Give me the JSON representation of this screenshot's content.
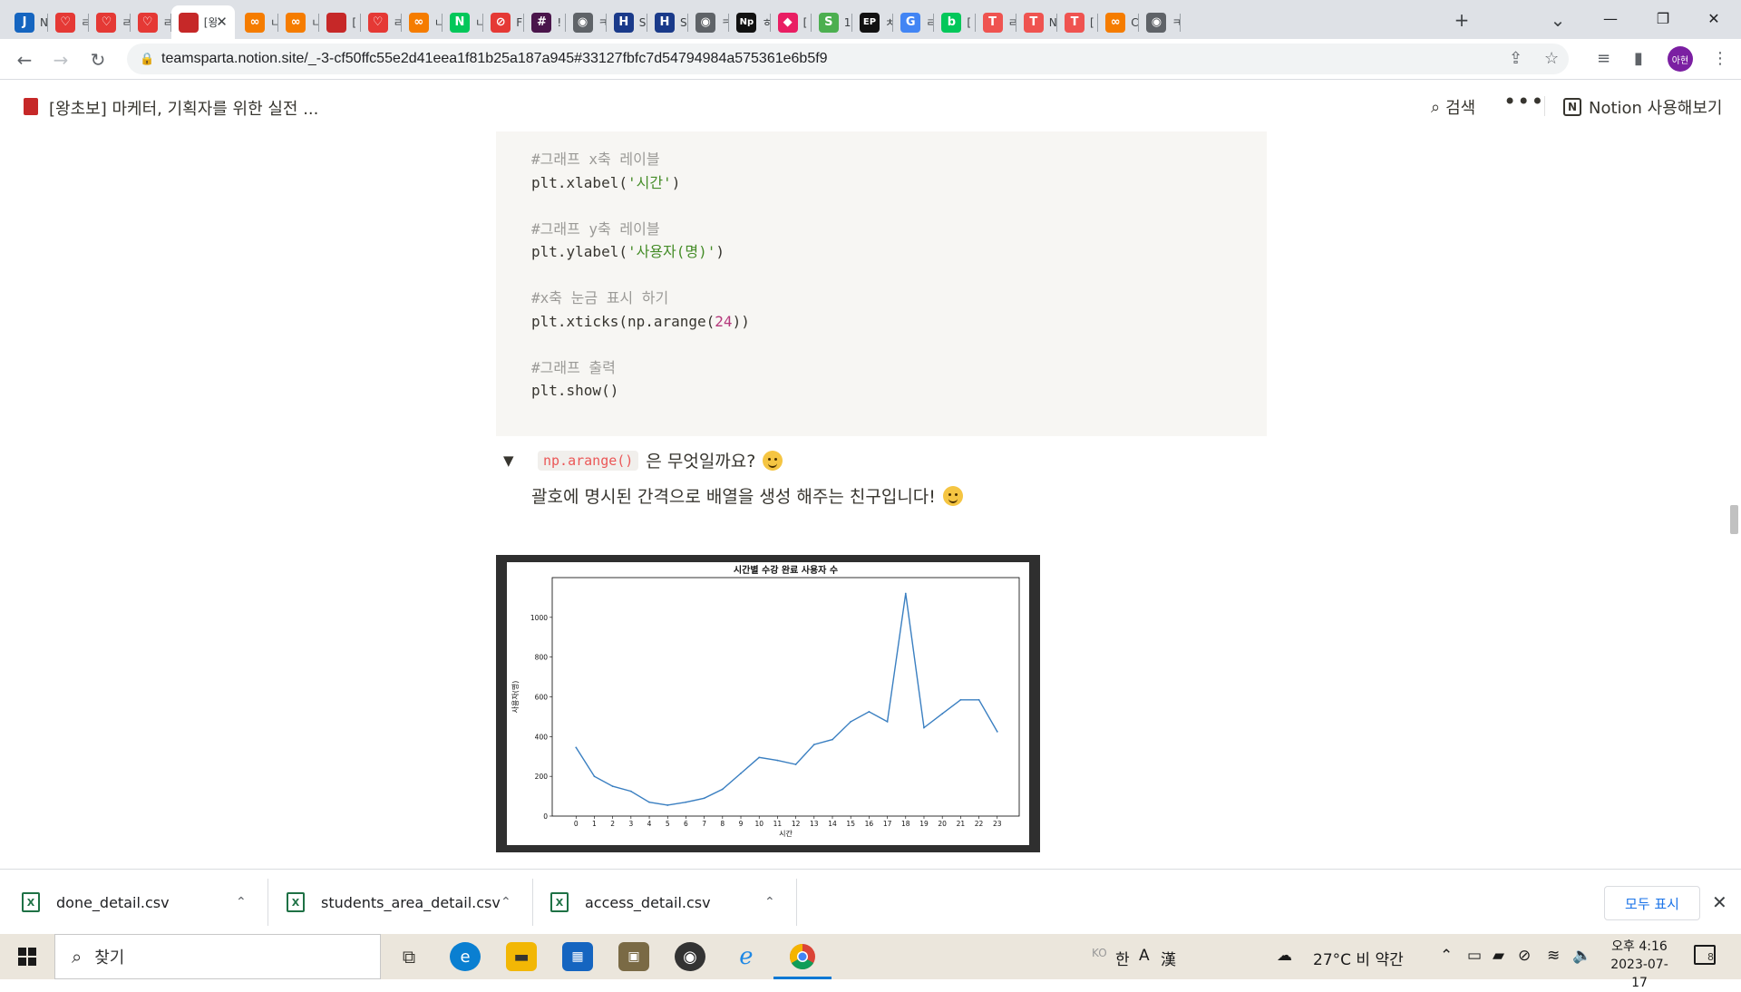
{
  "browser": {
    "tabs": [
      {
        "icon": "jira-icon",
        "short": "N",
        "color": "#1565c0",
        "glyph": "J"
      },
      {
        "icon": "heart-icon",
        "short": "ㄹ",
        "color": "#e53935",
        "glyph": "♡"
      },
      {
        "icon": "heart-icon",
        "short": "ㄹ",
        "color": "#e53935",
        "glyph": "♡"
      },
      {
        "icon": "heart-icon",
        "short": "ㄹ",
        "color": "#e53935",
        "glyph": "♡"
      },
      {
        "icon": "notion-book-icon",
        "short": "[왕",
        "color": "#c62828",
        "glyph": "",
        "active": true
      },
      {
        "icon": "infinity-icon",
        "short": "ㄴ",
        "color": "#f57c00",
        "glyph": "∞"
      },
      {
        "icon": "infinity-icon",
        "short": "ㄴ",
        "color": "#f57c00",
        "glyph": "∞"
      },
      {
        "icon": "notion-book-icon",
        "short": "[",
        "color": "#c62828",
        "glyph": ""
      },
      {
        "icon": "heart-icon",
        "short": "ㄹ",
        "color": "#e53935",
        "glyph": "♡"
      },
      {
        "icon": "infinity-icon",
        "short": "ㄴ",
        "color": "#f57c00",
        "glyph": "∞"
      },
      {
        "icon": "naver-icon",
        "short": "ㄴ",
        "color": "#03c75a",
        "glyph": "N"
      },
      {
        "icon": "ban-icon",
        "short": "F",
        "color": "#e53935",
        "glyph": "⊘"
      },
      {
        "icon": "slack-icon",
        "short": "!",
        "color": "#4a154b",
        "glyph": "#"
      },
      {
        "icon": "globe-icon",
        "short": "ㅋ",
        "color": "#5f6368",
        "glyph": "◉"
      },
      {
        "icon": "h-icon",
        "short": "S",
        "color": "#1a3a8a",
        "glyph": "H"
      },
      {
        "icon": "h-icon",
        "short": "S",
        "color": "#1a3a8a",
        "glyph": "H"
      },
      {
        "icon": "globe-icon",
        "short": "ㅋ",
        "color": "#5f6368",
        "glyph": "◉"
      },
      {
        "icon": "np-icon",
        "short": "ㅎ",
        "color": "#111111",
        "glyph": "Np"
      },
      {
        "icon": "diamond-icon",
        "short": "[",
        "color": "#e91e63",
        "glyph": "◆"
      },
      {
        "icon": "s-icon",
        "short": "1",
        "color": "#4caf50",
        "glyph": "S"
      },
      {
        "icon": "ep-icon",
        "short": "ㅊ",
        "color": "#111111",
        "glyph": "EP"
      },
      {
        "icon": "google-icon",
        "short": "ㄹ",
        "color": "#4285f4",
        "glyph": "G"
      },
      {
        "icon": "blog-icon",
        "short": "[",
        "color": "#03c75a",
        "glyph": "b"
      },
      {
        "icon": "t-circle-icon",
        "short": "ㄹ",
        "color": "#ef5350",
        "glyph": "T"
      },
      {
        "icon": "t-circle-icon",
        "short": "N",
        "color": "#ef5350",
        "glyph": "T"
      },
      {
        "icon": "t-circle-icon",
        "short": "[",
        "color": "#ef5350",
        "glyph": "T"
      },
      {
        "icon": "infinity-icon",
        "short": "C",
        "color": "#f57c00",
        "glyph": "∞"
      },
      {
        "icon": "globe-icon",
        "short": "ㅋ",
        "color": "#5f6368",
        "glyph": "◉"
      }
    ],
    "url": "teamsparta.notion.site/_-3-cf50ffc55e2d41eea1f81b25a187a945#33127fbfc7d54794984a575361e6b5f9",
    "profile": "아현"
  },
  "notion": {
    "page_title": "[왕초보] 마케터, 기획자를 위한 실전 ...",
    "search_label": "검색",
    "more_label": "•••",
    "try_label": "Notion 사용해보기"
  },
  "code": {
    "lines": [
      {
        "type": "comment",
        "text": "#그래프 x축 레이블"
      },
      {
        "type": "call",
        "pre": "plt.xlabel(",
        "str": "'시간'",
        "post": ")"
      },
      {
        "type": "blank"
      },
      {
        "type": "comment",
        "text": "#그래프 y축 레이블"
      },
      {
        "type": "call",
        "pre": "plt.ylabel(",
        "str": "'사용자(명)'",
        "post": ")"
      },
      {
        "type": "blank"
      },
      {
        "type": "comment",
        "text": "#x축 눈금 표시 하기"
      },
      {
        "type": "num",
        "pre": "plt.xticks(np.arange(",
        "num": "24",
        "post": "))"
      },
      {
        "type": "blank"
      },
      {
        "type": "comment",
        "text": "#그래프 출력"
      },
      {
        "type": "plain",
        "text": "plt.show()"
      }
    ]
  },
  "toggle": {
    "code": "np.arange()",
    "question": "은 무엇일까요?",
    "answer": "괄호에 명시된 간격으로 배열을 생성 해주는 친구입니다!"
  },
  "chart_data": {
    "type": "line",
    "title": "시간별 수강 완료 사용자 수",
    "xlabel": "시간",
    "ylabel": "사용자(명)",
    "x": [
      0,
      1,
      2,
      3,
      4,
      5,
      6,
      7,
      8,
      9,
      10,
      11,
      12,
      13,
      14,
      15,
      16,
      17,
      18,
      19,
      20,
      21,
      22,
      23
    ],
    "values": [
      345,
      200,
      150,
      125,
      70,
      55,
      70,
      90,
      135,
      215,
      295,
      280,
      260,
      360,
      385,
      475,
      525,
      475,
      1120,
      445,
      515,
      585,
      585,
      425
    ],
    "ylim": [
      0,
      1200
    ],
    "yticks": [
      0,
      200,
      400,
      600,
      800,
      1000
    ],
    "line_color": "#3a7fc1",
    "grid": false
  },
  "downloads": {
    "items": [
      "done_detail.csv",
      "students_area_detail.csv",
      "access_detail.csv"
    ],
    "show_all": "모두 표시"
  },
  "taskbar": {
    "search_placeholder": "찾기",
    "ime_lang": "KO",
    "ime_hangul": "한",
    "ime_a": "A",
    "ime_han": "漢",
    "weather": "27°C  비 약간",
    "time": "오후 4:16",
    "date": "2023-07-17",
    "notifications": "8"
  }
}
